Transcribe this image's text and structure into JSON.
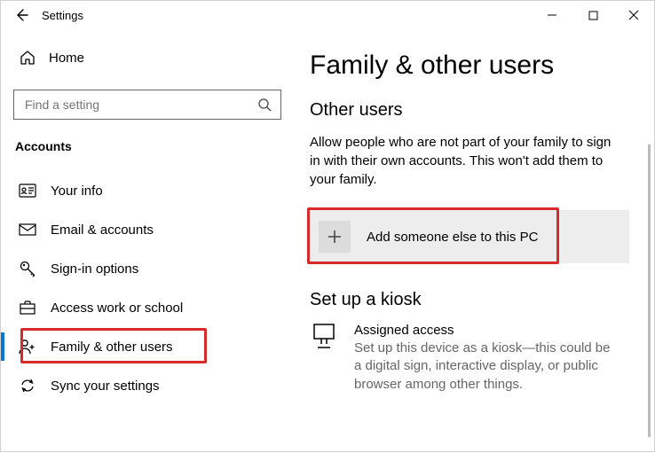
{
  "titlebar": {
    "app_title": "Settings"
  },
  "sidebar": {
    "home_label": "Home",
    "search_placeholder": "Find a setting",
    "section_label": "Accounts",
    "items": [
      {
        "label": "Your info"
      },
      {
        "label": "Email & accounts"
      },
      {
        "label": "Sign-in options"
      },
      {
        "label": "Access work or school"
      },
      {
        "label": "Family & other users"
      },
      {
        "label": "Sync your settings"
      }
    ]
  },
  "main": {
    "page_title": "Family & other users",
    "other_users_heading": "Other users",
    "other_users_desc": "Allow people who are not part of your family to sign in with their own accounts. This won't add them to your family.",
    "add_button_label": "Add someone else to this PC",
    "kiosk_heading": "Set up a kiosk",
    "kiosk_title": "Assigned access",
    "kiosk_desc": "Set up this device as a kiosk—this could be a digital sign, interactive display, or public browser among other things."
  }
}
